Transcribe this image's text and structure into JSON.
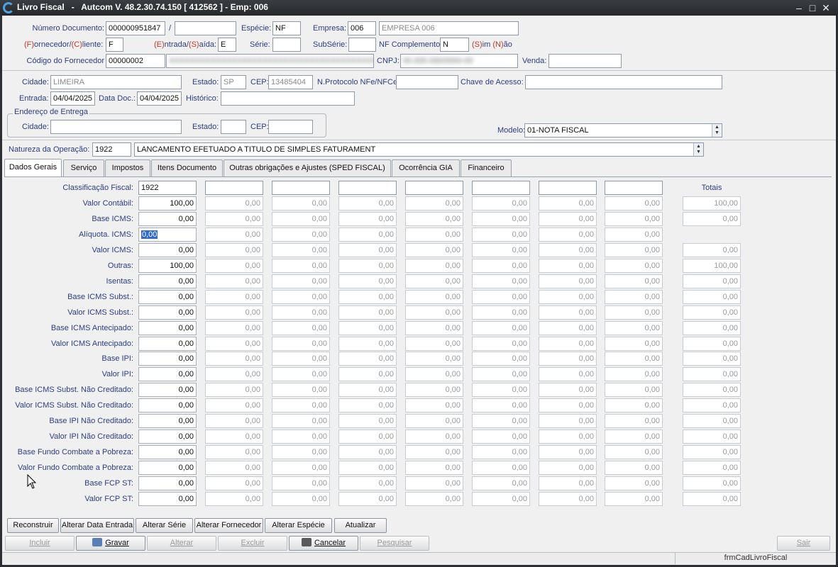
{
  "window": {
    "title": "Livro Fiscal   -   Autcom V. 48.2.30.74.150 [ 412562 ] - Emp: 006",
    "minimize": "–",
    "maximize": "□",
    "close": "✕"
  },
  "header": {
    "numero_documento": {
      "label": "Número Documento:",
      "value": "000000951847",
      "slash": "/",
      "value2": ""
    },
    "especie": {
      "label": "Espécie:",
      "value": "NF"
    },
    "empresa": {
      "label": "Empresa:",
      "code": "006",
      "name": "EMPRESA 006"
    },
    "fornecedor_cliente": {
      "label_a": "(F)",
      "label_b": "ornecedor/",
      "label_c": "(C)",
      "label_d": "liente:",
      "value": "F"
    },
    "entrada_saida": {
      "label_a": "(E)",
      "label_b": "ntrada/",
      "label_c": "(S)",
      "label_d": "aída:",
      "value": "E"
    },
    "serie": {
      "label": "Série:",
      "value": ""
    },
    "subserie": {
      "label": "SubSérie:",
      "value": ""
    },
    "nf_complemento": {
      "label": "NF Complemento:",
      "value": "N",
      "hint_a": "(S)",
      "hint_b": "im ",
      "hint_c": "(N)",
      "hint_d": "ão"
    },
    "codigo_fornecedor": {
      "label": "Código do Fornecedor",
      "value": "00000002",
      "name_blurred": "XXXXXXXXXXXXXXXXXXXXXXXXXXXXXXXXXXXXXXXX"
    },
    "cnpj": {
      "label": "CNPJ:",
      "value_blurred": "00.000.000/0000-00"
    },
    "venda": {
      "label": "Venda:",
      "value": ""
    }
  },
  "location": {
    "cidade": {
      "label": "Cidade:",
      "value": "LIMEIRA"
    },
    "estado": {
      "label": "Estado:",
      "value": "SP"
    },
    "cep": {
      "label": "CEP:",
      "value": "13485404"
    },
    "protocolo": {
      "label": "N.Protocolo NFe/NFCe:",
      "value": ""
    },
    "chave": {
      "label": "Chave de Acesso:",
      "value": ""
    },
    "entrada": {
      "label": "Entrada:",
      "value": "04/04/2025"
    },
    "data_doc": {
      "label": "Data Doc.:",
      "value": "04/04/2025"
    },
    "historico": {
      "label": "Histórico:",
      "value": ""
    }
  },
  "entrega": {
    "title": "Endereço de Entrega",
    "cidade": {
      "label": "Cidade:",
      "value": ""
    },
    "estado": {
      "label": "Estado:",
      "value": ""
    },
    "cep": {
      "label": "CEP:",
      "value": ""
    }
  },
  "modelo": {
    "label": "Modelo:",
    "value": "01-NOTA FISCAL"
  },
  "natureza": {
    "label": "Natureza da Operação:",
    "code": "1922",
    "description": "LANCAMENTO EFETUADO A TITULO DE SIMPLES FATURAMENT"
  },
  "tabs": [
    {
      "label": "Dados Gerais",
      "active": true
    },
    {
      "label": "Serviço"
    },
    {
      "label": "Impostos"
    },
    {
      "label": "Itens Documento"
    },
    {
      "label": "Outras obrigações e Ajustes (SPED FISCAL)"
    },
    {
      "label": "Ocorrência GIA"
    },
    {
      "label": "Financeiro"
    }
  ],
  "grid": {
    "classificacao_label": "Classificação Fiscal:",
    "classificacao_values": [
      "1922",
      "",
      "",
      "",
      "",
      "",
      "",
      ""
    ],
    "totais_label": "Totais",
    "empty_value": "0,00",
    "rows": [
      {
        "label": "Valor Contábil:",
        "main": "100,00",
        "total": "100,00"
      },
      {
        "label": "Base ICMS:",
        "main": "0,00",
        "total": "0,00"
      },
      {
        "label": "Alíquota. ICMS:",
        "main": "0,00",
        "total": "",
        "selected": true
      },
      {
        "label": "Valor ICMS:",
        "main": "0,00",
        "total": "0,00"
      },
      {
        "label": "Outras:",
        "main": "100,00",
        "total": "100,00"
      },
      {
        "label": "Isentas:",
        "main": "0,00",
        "total": "0,00"
      },
      {
        "label": "Base ICMS Subst.:",
        "main": "0,00",
        "total": "0,00"
      },
      {
        "label": "Valor ICMS Subst.:",
        "main": "0,00",
        "total": "0,00"
      },
      {
        "label": "Base ICMS Antecipado:",
        "main": "0,00",
        "total": "0,00"
      },
      {
        "label": "Valor ICMS Antecipado:",
        "main": "0,00",
        "total": "0,00"
      },
      {
        "label": "Base IPI:",
        "main": "0,00",
        "total": "0,00"
      },
      {
        "label": "Valor IPI:",
        "main": "0,00",
        "total": "0,00"
      },
      {
        "label": "Base ICMS Subst. Não Creditado:",
        "main": "0,00",
        "total": "0,00"
      },
      {
        "label": "Valor ICMS Subst. Não Creditado:",
        "main": "0,00",
        "total": "0,00"
      },
      {
        "label": "Base IPI Não Creditado:",
        "main": "0,00",
        "total": "0,00"
      },
      {
        "label": "Valor IPI Não Creditado:",
        "main": "0,00",
        "total": "0,00"
      },
      {
        "label": "Base Fundo Combate a Pobreza:",
        "main": "0,00",
        "total": "0,00"
      },
      {
        "label": "Valor Fundo Combate a Pobreza:",
        "main": "0,00",
        "total": "0,00"
      },
      {
        "label": "Base FCP ST:",
        "main": "0,00",
        "total": "0,00"
      },
      {
        "label": "Valor FCP ST:",
        "main": "0,00",
        "total": "0,00"
      }
    ]
  },
  "actions": [
    "Reconstruir",
    "Alterar Data Entrada",
    "Alterar Série",
    "Alterar Fornecedor",
    "Alterar Espécie",
    "Atualizar"
  ],
  "crud": [
    {
      "label": "Incluir",
      "enabled": false
    },
    {
      "label": "Gravar",
      "enabled": true,
      "icon": "printer-icon"
    },
    {
      "label": "Alterar",
      "enabled": false
    },
    {
      "label": "Excluir",
      "enabled": false
    },
    {
      "label": "Cancelar",
      "enabled": true,
      "icon": "cancel-icon"
    },
    {
      "label": "Pesquisar",
      "enabled": false
    }
  ],
  "sair": "Sair",
  "status": {
    "form_name": "frmCadLivroFiscal"
  }
}
